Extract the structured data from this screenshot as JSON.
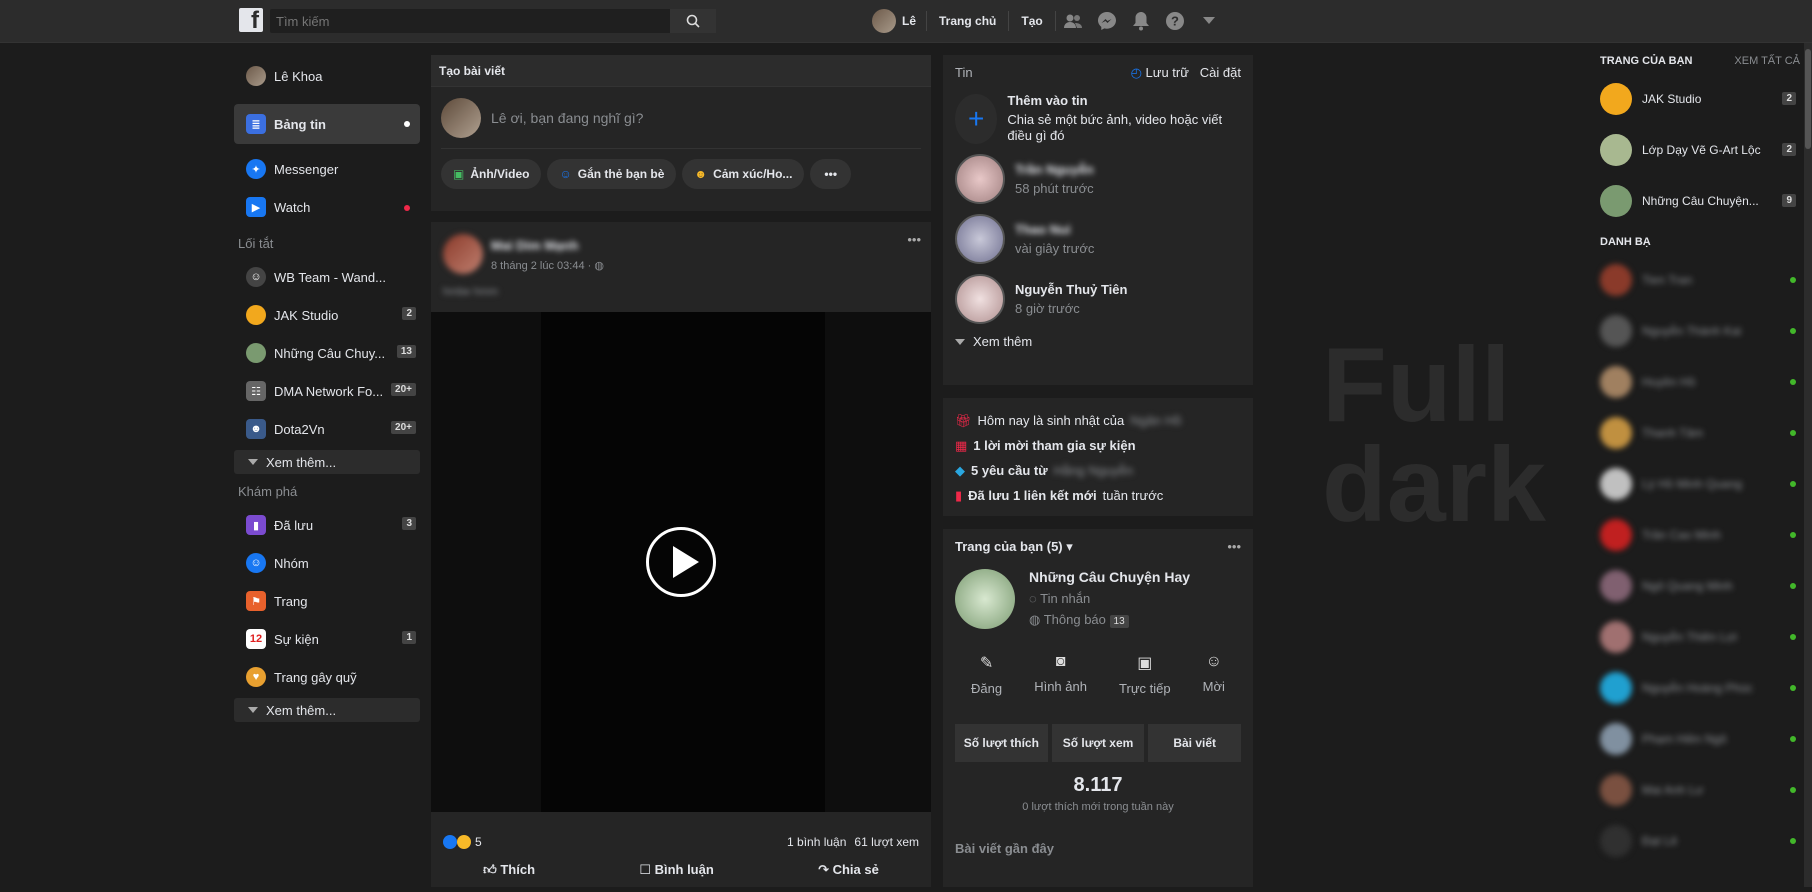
{
  "topbar": {
    "search_placeholder": "Tìm kiếm",
    "user_name": "Lê",
    "home_label": "Trang chủ",
    "create_label": "Tạo"
  },
  "left": {
    "profile_name": "Lê Khoa",
    "items": [
      {
        "label": "Bảng tin"
      },
      {
        "label": "Messenger"
      },
      {
        "label": "Watch"
      }
    ],
    "shortcuts_title": "Lối tắt",
    "shortcuts": [
      {
        "label": "WB Team - Wand...",
        "badge": ""
      },
      {
        "label": "JAK Studio",
        "badge": "2"
      },
      {
        "label": "Những Câu Chuy...",
        "badge": "13"
      },
      {
        "label": "DMA Network Fo...",
        "badge": "20+"
      },
      {
        "label": "Dota2Vn",
        "badge": "20+"
      }
    ],
    "see_more": "Xem thêm...",
    "explore_title": "Khám phá",
    "explore": [
      {
        "label": "Đã lưu",
        "badge": "3"
      },
      {
        "label": "Nhóm",
        "badge": ""
      },
      {
        "label": "Trang",
        "badge": ""
      },
      {
        "label": "Sự kiện",
        "badge": "1"
      },
      {
        "label": "Trang gây quỹ",
        "badge": ""
      }
    ]
  },
  "composer": {
    "title": "Tạo bài viết",
    "placeholder": "Lê ơi, bạn đang nghĩ gì?",
    "actions": [
      "Ảnh/Video",
      "Gắn thẻ bạn bè",
      "Cảm xúc/Ho..."
    ]
  },
  "post": {
    "author": "Mai Dim Mạnh",
    "time": "8 tháng 2 lúc 03:44 ·",
    "caption": "hmbe hmm",
    "reactions_count": "5",
    "comments": "1 bình luận",
    "views": "61 lượt xem",
    "like_label": "Thích",
    "comment_label": "Bình luận",
    "share_label": "Chia sẻ"
  },
  "stories": {
    "title": "Tin",
    "archive": "Lưu trữ",
    "settings": "Cài đặt",
    "add_title": "Thêm vào tin",
    "add_desc": "Chia sẻ một bức ảnh, video hoặc viết điều gì đó",
    "items": [
      {
        "name": "Trần Nguyễn",
        "time": "58 phút trước"
      },
      {
        "name": "Thao Nui",
        "time": "vài giây trước"
      },
      {
        "name": "Nguyễn Thuỷ Tiên",
        "time": "8 giờ trước"
      }
    ],
    "see_more": "Xem thêm"
  },
  "notes": {
    "birthday": "Hôm nay là sinh nhật của",
    "birthday_name": "Ngân Hồ",
    "event": "1 lời mời tham gia sự kiện",
    "requests": "5 yêu cầu từ",
    "requests_name": "Hằng Nguyễn",
    "saved": "Đã lưu 1 liên kết mới",
    "saved_suffix": "tuần trước"
  },
  "pages": {
    "title": "Trang của bạn (5)",
    "name": "Những Câu Chuyện Hay",
    "messages": "Tin nhắn",
    "notifications": "Thông báo",
    "notif_badge": "13",
    "tools": [
      "Đăng",
      "Hình ảnh",
      "Trực tiếp",
      "Mời"
    ],
    "tabs": [
      "Số lượt thích",
      "Số lượt xem",
      "Bài viết"
    ],
    "likes": "8.117",
    "likes_desc": "0 lượt thích mới trong tuần này",
    "recent": "Bài viết gần đây"
  },
  "watermark": {
    "line1": "Full",
    "line2": "dark"
  },
  "chat": {
    "pages_title": "TRANG CỦA BẠN",
    "see_all": "XEM TẤT CẢ",
    "pages": [
      {
        "name": "JAK Studio",
        "badge": "2"
      },
      {
        "name": "Lớp Dạy Vẽ G-Art Lộc",
        "badge": "2"
      },
      {
        "name": "Những Câu Chuyện...",
        "badge": "9"
      }
    ],
    "contacts_title": "DANH BẠ",
    "contacts": [
      {
        "name": "Tien Tran",
        "color": "#8a3a2a"
      },
      {
        "name": "Nguyễn Thành Kai",
        "color": "#555"
      },
      {
        "name": "Huyền Hồ",
        "color": "#a08060"
      },
      {
        "name": "Thanh Tâm",
        "color": "#c09040"
      },
      {
        "name": "Lý Hồ Minh Quang",
        "color": "#c0c0c0"
      },
      {
        "name": "Trần Cao Minh",
        "color": "#c02020"
      },
      {
        "name": "Ngô Quang Minh",
        "color": "#806070"
      },
      {
        "name": "Nguyễn Thiên Lợi",
        "color": "#a07070"
      },
      {
        "name": "Nguyễn Hoàng Phúc",
        "color": "#20a0d0"
      },
      {
        "name": "Phạm Hiền Ngô",
        "color": "#8090a0"
      },
      {
        "name": "Mai Anh Lư",
        "color": "#7a5040"
      },
      {
        "name": "Đạt Lê",
        "color": "#303030"
      }
    ]
  }
}
